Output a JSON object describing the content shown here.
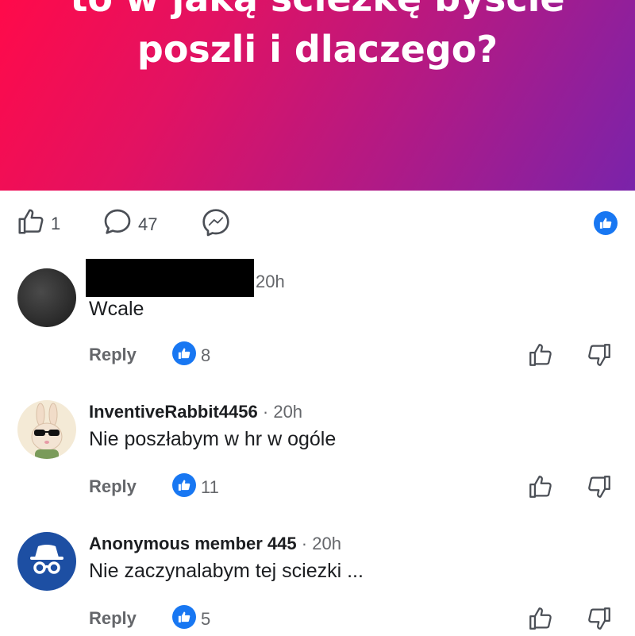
{
  "banner": {
    "title_cut": "to w jaką ścieżkę byście",
    "title_line": "poszli i dlaczego?"
  },
  "post_actions": {
    "like_count": "1",
    "comment_count": "47"
  },
  "comments": [
    {
      "author": "",
      "time": "20h",
      "text": "Wcale",
      "reply_label": "Reply",
      "likes": "8"
    },
    {
      "author": "InventiveRabbit4456",
      "dot": "·",
      "time": "20h",
      "text": "Nie poszłabym w hr w ogóle",
      "reply_label": "Reply",
      "likes": "11"
    },
    {
      "author": "Anonymous member 445",
      "dot": "·",
      "time": "20h",
      "text": "Nie zaczynalabym tej sciezki ...",
      "reply_label": "Reply",
      "likes": "5"
    }
  ],
  "colors": {
    "accent": "#1877f2",
    "banner_start": "#ff0a4a",
    "banner_end": "#7a23aa",
    "anon_avatar": "#1d4fa3"
  },
  "icons": [
    "thumbs-up-icon",
    "comment-bubble-icon",
    "messenger-icon",
    "blue-like-icon",
    "thumbs-down-icon",
    "incognito-icon",
    "rabbit-avatar"
  ]
}
